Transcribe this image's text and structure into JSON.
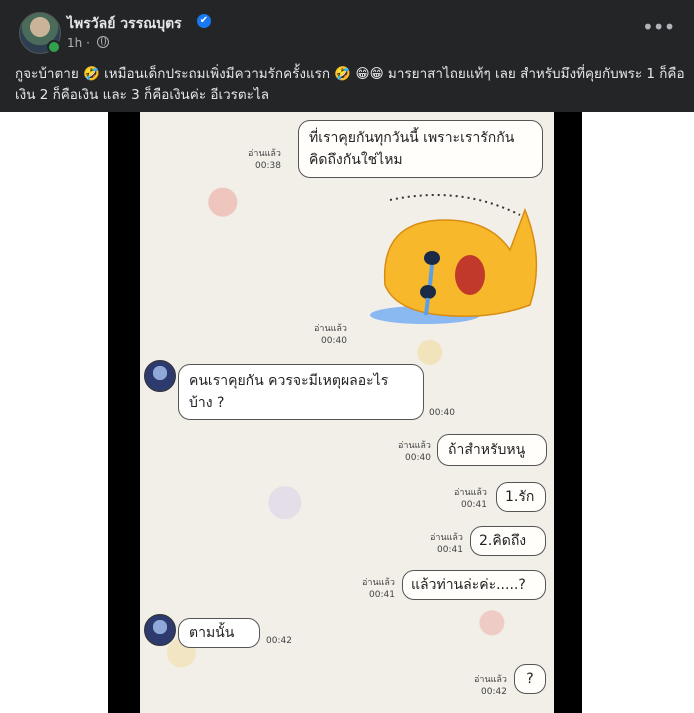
{
  "post": {
    "author": "ไพรวัลย์ วรรณบุตร",
    "verified_icon": "✔",
    "time": "1h",
    "more_icon": "•••",
    "caption": "กูจะบ้าตาย 🤣 เหมือนเด็กประถมเพิ่งมีความรักครั้งแรก 🤣 😁😁 มารยาสาไถยแท้ๆ เลย สำหรับมึงที่คุยกับพระ 1 ก็คือเงิน 2 ก็คือเงิน และ 3 ก็คือเงินค่ะ อีเวรตะไล"
  },
  "chat": {
    "messages": [
      {
        "side": "out",
        "text_line1": "ที่เราคุยกันทุกวันนี้ เพราะเรารักกัน",
        "text_line2": "คิดถึงกันใช่ไหม",
        "read": "อ่านแล้ว",
        "time": "00:38"
      },
      {
        "side": "out",
        "type": "sticker",
        "read": "อ่านแล้ว",
        "time": "00:40"
      },
      {
        "side": "in",
        "text_line1": "คนเราคุยกัน ควรจะมีเหตุผลอะไร",
        "text_line2": "บ้าง ?",
        "time": "00:40"
      },
      {
        "side": "out",
        "text": "ถ้าสำหรับหนู",
        "read": "อ่านแล้ว",
        "time": "00:40"
      },
      {
        "side": "out",
        "text": "1.รัก",
        "read": "อ่านแล้ว",
        "time": "00:41"
      },
      {
        "side": "out",
        "text": "2.คิดถึง",
        "read": "อ่านแล้ว",
        "time": "00:41"
      },
      {
        "side": "out",
        "text": "แล้วท่านล่ะค่ะ.....?",
        "read": "อ่านแล้ว",
        "time": "00:41"
      },
      {
        "side": "in",
        "text": "ตามนั้น",
        "time": "00:42"
      },
      {
        "side": "out",
        "text": "?",
        "read": "อ่านแล้ว",
        "time": "00:42"
      }
    ]
  }
}
